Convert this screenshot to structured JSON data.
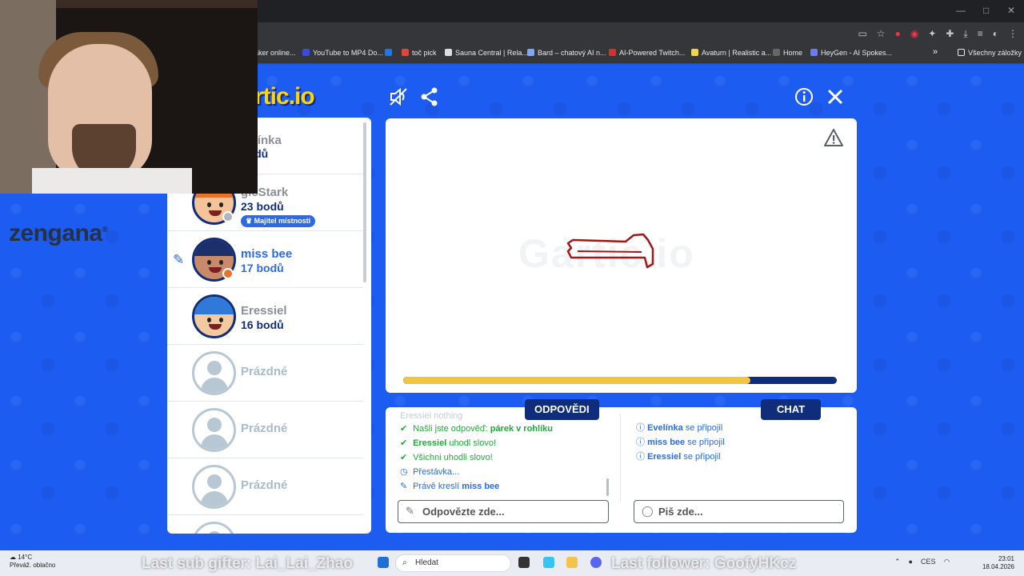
{
  "window": {
    "minimize": "—",
    "maximize": "□",
    "close": "✕"
  },
  "bookmarks": [
    {
      "label": "aker online...",
      "color": "#888888"
    },
    {
      "label": "YouTube to MP4 Do...",
      "color": "#3b4cd8"
    },
    {
      "label": "",
      "color": "#1877f2"
    },
    {
      "label": "toč pick",
      "color": "#e0463c"
    },
    {
      "label": "Sauna Central | Rela...",
      "color": "#dddddd"
    },
    {
      "label": "Bard – chatový AI n...",
      "color": "#7aa7ff"
    },
    {
      "label": "AI-Powered Twitch...",
      "color": "#d93025"
    },
    {
      "label": "Avaturn | Realistic a...",
      "color": "#f0d64b"
    },
    {
      "label": "Home",
      "color": "#666666"
    },
    {
      "label": "HeyGen - AI Spokes...",
      "color": "#6a7bff"
    }
  ],
  "bookmarks_more": "»",
  "bookmarks_folder": "Všechny záložky",
  "game": {
    "logo": "rtic.io",
    "mute_icon": "mute-icon",
    "share_icon": "share-icon",
    "info_icon": "info-icon",
    "close_icon": "close-icon",
    "canvas_watermark": "Gartic.io",
    "progress_fraction": 0.8,
    "accent": "#2a6ae8",
    "navy": "#0f2d7a",
    "yellow": "#f2c443"
  },
  "players": [
    {
      "name": "velínka",
      "points": "bodů",
      "state": "normal"
    },
    {
      "name": "gicStark",
      "points": "23 bodů",
      "state": "normal",
      "badge": "Majitel místnosti"
    },
    {
      "name": "miss bee",
      "points": "17 bodů",
      "state": "drawing"
    },
    {
      "name": "Eressiel",
      "points": "16 bodů",
      "state": "normal"
    },
    {
      "name": "Prázdné",
      "state": "empty"
    },
    {
      "name": "Prázdné",
      "state": "empty"
    },
    {
      "name": "Prázdné",
      "state": "empty"
    }
  ],
  "tabs": {
    "answers": "ODPOVĚDI",
    "chat": "CHAT"
  },
  "answers_log": {
    "faded": "Eressiel nothing",
    "found_prefix": "Našli jste odpověď:",
    "found_word": "párek v rohlíku",
    "guessed_name": "Eressiel",
    "guessed_text": "uhodl slovo!",
    "all_guessed": "Všichni uhodli slovo!",
    "pause": "Přestávka...",
    "drawing_prefix": "Právě kreslí",
    "drawing_name": "miss bee"
  },
  "chat_log": [
    {
      "name": "Evelínka",
      "text": "se připojil"
    },
    {
      "name": "miss bee",
      "text": "se připojil"
    },
    {
      "name": "Eressiel",
      "text": "se připojil"
    }
  ],
  "answer_input": {
    "placeholder": "Odpovězte zde..."
  },
  "chat_input": {
    "placeholder": "Piš zde..."
  },
  "brand": "zengana",
  "brand_mark": "®",
  "taskbar": {
    "temp": "14°C",
    "weather": "Převáž. oblačno",
    "search": "Hledat",
    "lang": "CES",
    "time": "23:01",
    "date": "18.04.2026"
  },
  "stream_overlay": {
    "sub_gifter": "Last sub gifter: Lai_Lai_Zhao",
    "follower": "Last follower: GoofyHKcz"
  }
}
